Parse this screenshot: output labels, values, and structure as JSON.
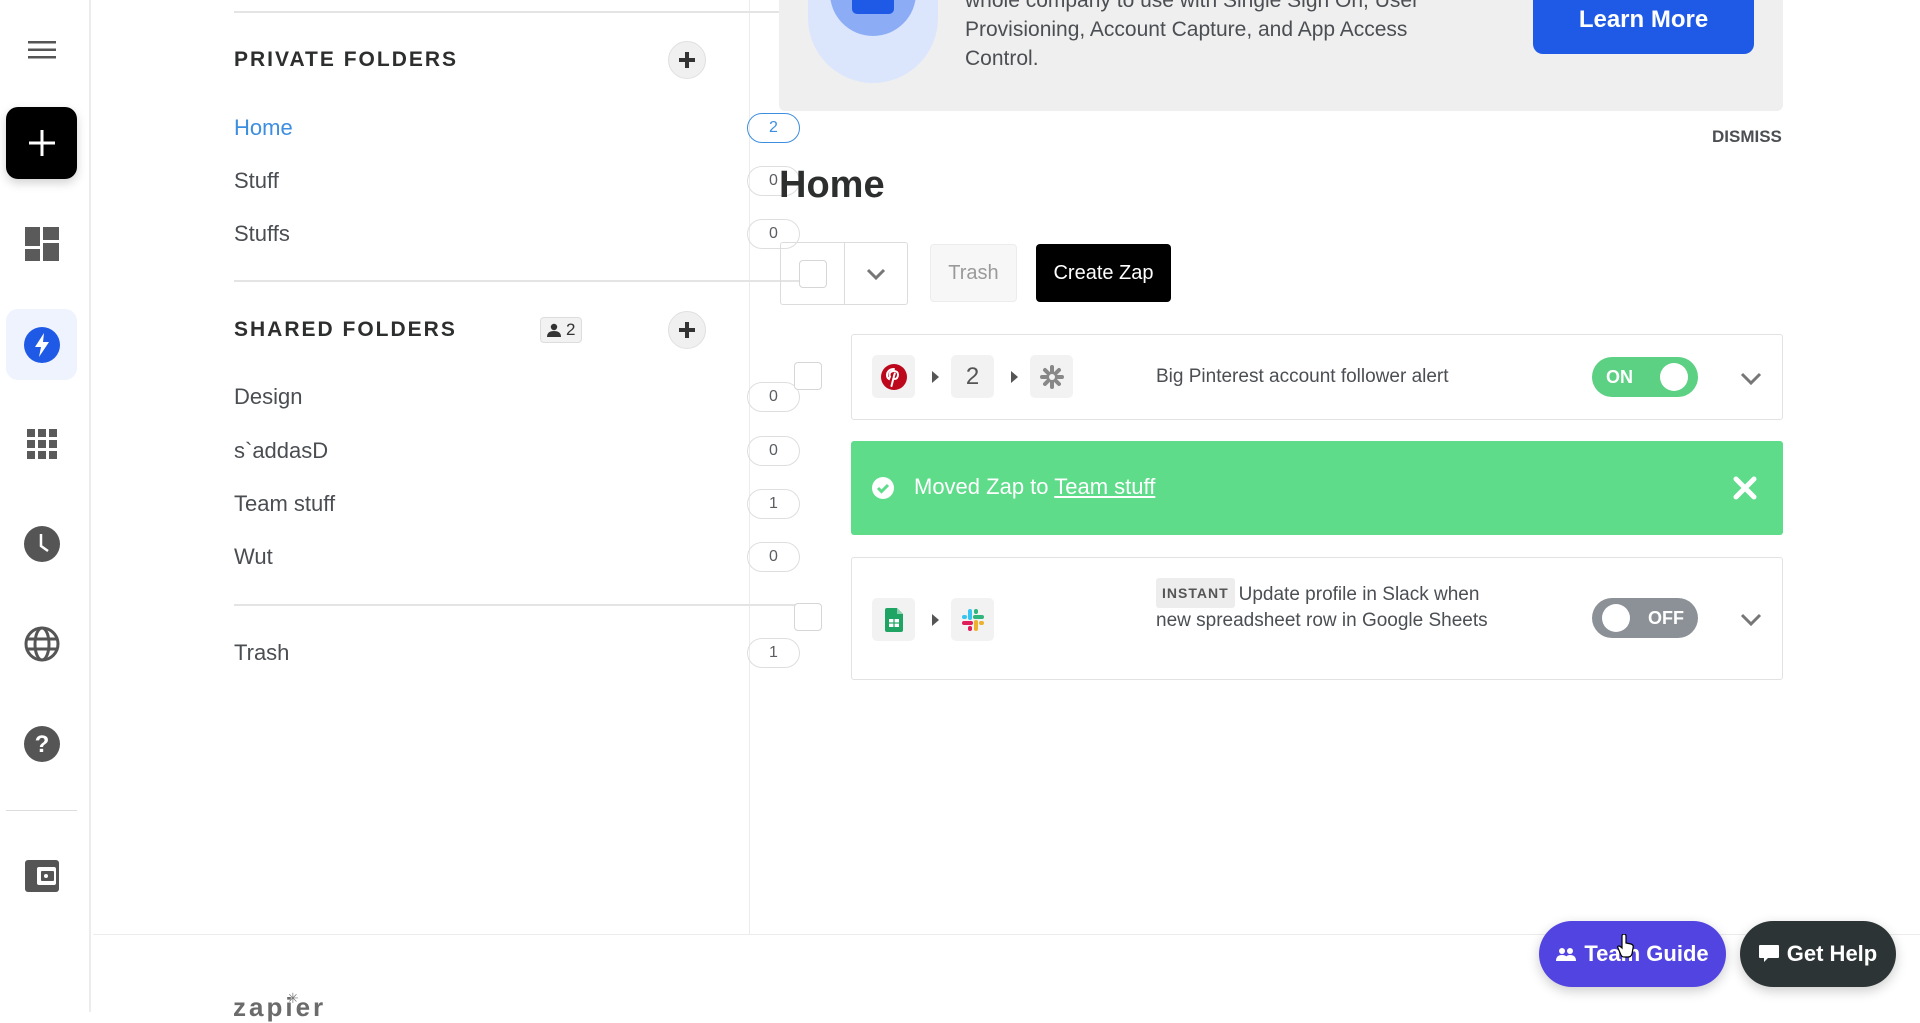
{
  "rail": {
    "items": [
      {
        "name": "menu",
        "icon": "hamburger-menu-icon"
      },
      {
        "name": "create",
        "icon": "plus-icon"
      },
      {
        "name": "dashboard",
        "icon": "dashboard-icon"
      },
      {
        "name": "zaps",
        "icon": "bolt-icon",
        "active": true
      },
      {
        "name": "apps",
        "icon": "apps-grid-icon"
      },
      {
        "name": "history",
        "icon": "clock-icon"
      },
      {
        "name": "explore",
        "icon": "globe-icon"
      },
      {
        "name": "help",
        "icon": "help-icon"
      },
      {
        "name": "billing",
        "icon": "wallet-icon"
      }
    ],
    "accent": "#1f5ae6"
  },
  "folders": {
    "private_title": "PRIVATE FOLDERS",
    "private": [
      {
        "name": "Home",
        "count": "2",
        "active": true
      },
      {
        "name": "Stuff",
        "count": "0"
      },
      {
        "name": "Stuffs",
        "count": "0"
      }
    ],
    "shared_title": "SHARED FOLDERS",
    "shared_members": "2",
    "shared": [
      {
        "name": "Design",
        "count": "0"
      },
      {
        "name": "s`addasD",
        "count": "0"
      },
      {
        "name": "Team stuff",
        "count": "1"
      },
      {
        "name": "Wut",
        "count": "0"
      }
    ],
    "trash": {
      "name": "Trash",
      "count": "1"
    }
  },
  "banner": {
    "text": "whole company to use with Single Sign On, User Provisioning, Account Capture, and App Access Control.",
    "learn_more": "Learn More",
    "dismiss": "DISMISS"
  },
  "main": {
    "title": "Home",
    "trash_label": "Trash",
    "create_label": "Create Zap",
    "zaps": [
      {
        "title": "Big Pinterest account follower alert",
        "steps_count": "2",
        "status": "ON",
        "enabled": true,
        "apps": [
          "pinterest",
          "zapier-step"
        ]
      },
      {
        "badge": "INSTANT",
        "title": "Update profile in Slack when new spreadsheet row in Google Sheets",
        "status": "OFF",
        "enabled": false,
        "apps": [
          "google-sheets",
          "slack"
        ]
      }
    ],
    "toast": {
      "prefix": "Moved Zap to ",
      "link": "Team stuff",
      "color": "#5edc8a"
    }
  },
  "footer": {
    "logo": "zapier",
    "team_guide": "Team Guide",
    "get_help": "Get Help"
  }
}
